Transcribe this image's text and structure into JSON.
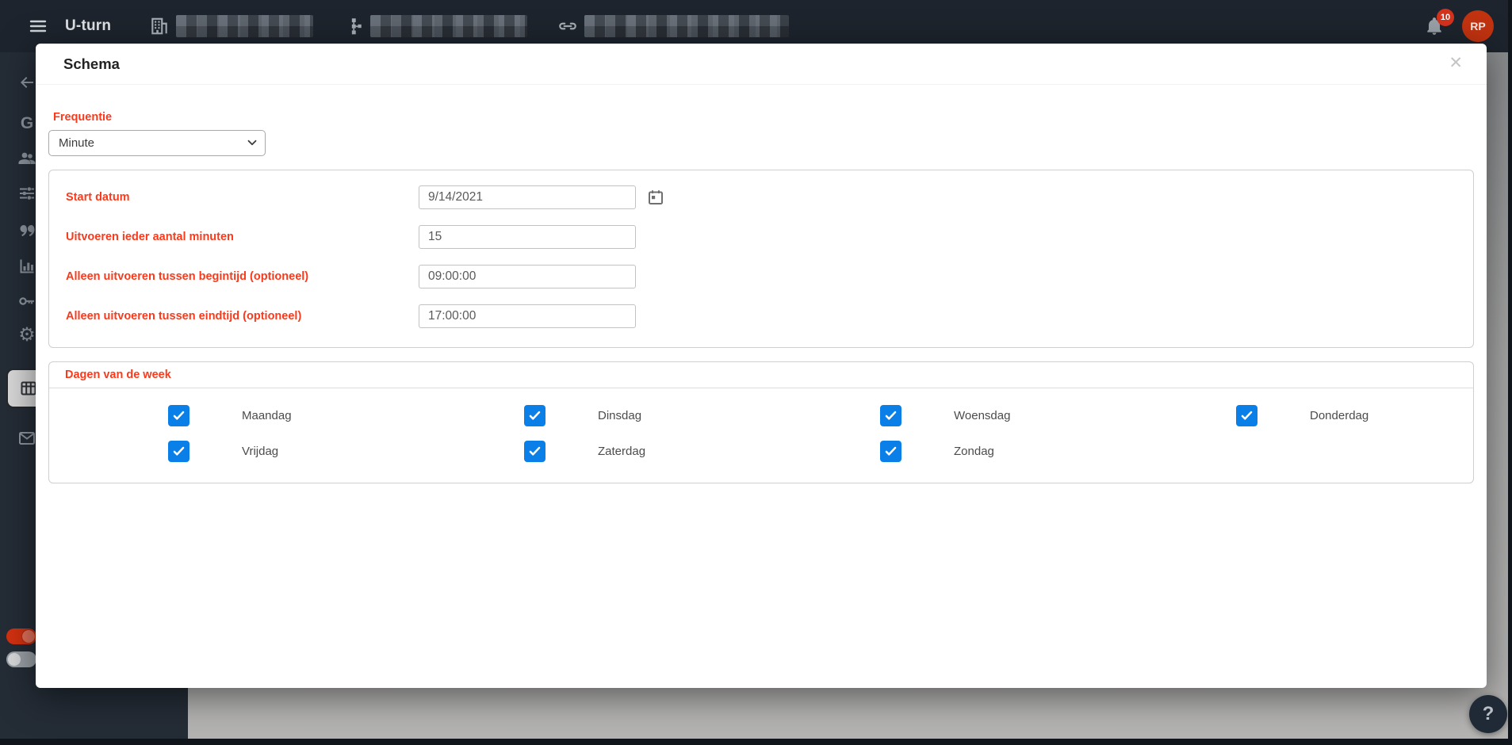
{
  "topbar": {
    "brand": "U-turn",
    "nav_items": [
      {
        "icon": "building-icon"
      },
      {
        "icon": "sitemap-icon"
      },
      {
        "icon": "link-icon"
      }
    ],
    "notification_badge": "10",
    "avatar_initials": "RP"
  },
  "sidebar": {
    "items": [
      {
        "icon": "arrow-left-icon"
      },
      {
        "icon": "globe-icon"
      },
      {
        "icon": "people-icon"
      },
      {
        "icon": "tune-icon"
      },
      {
        "icon": "quote-icon"
      },
      {
        "icon": "bar-chart-icon"
      },
      {
        "icon": "key-icon"
      },
      {
        "icon": "gear-icon"
      },
      {
        "icon": "table-icon",
        "selected": true
      },
      {
        "icon": "mail-icon"
      }
    ],
    "toggles": [
      {
        "state": "on"
      },
      {
        "state": "off"
      }
    ]
  },
  "modal": {
    "title": "Schema",
    "close_glyph": "✕",
    "frequency_label": "Frequentie",
    "frequency_value": "Minute",
    "fields": [
      {
        "label": "Start datum",
        "value": "9/14/2021",
        "trailing_icon": "calendar-icon"
      },
      {
        "label": "Uitvoeren ieder aantal minuten",
        "value": "15"
      },
      {
        "label": "Alleen uitvoeren tussen begintijd (optioneel)",
        "value": "09:00:00"
      },
      {
        "label": "Alleen uitvoeren tussen eindtijd (optioneel)",
        "value": "17:00:00"
      }
    ],
    "days_label": "Dagen van de week",
    "days": [
      {
        "label": "Maandag",
        "checked": true
      },
      {
        "label": "Dinsdag",
        "checked": true
      },
      {
        "label": "Woensdag",
        "checked": true
      },
      {
        "label": "Donderdag",
        "checked": true
      },
      {
        "label": "Vrijdag",
        "checked": true
      },
      {
        "label": "Zaterdag",
        "checked": true
      },
      {
        "label": "Zondag",
        "checked": true
      }
    ]
  },
  "help_button_label": "?",
  "colors": {
    "accent_red": "#fa3a1c",
    "checkbox_blue": "#0b7fe8",
    "avatar_bg": "#c23310",
    "badge_bg": "#d5321d",
    "toggle_on": "#d23110",
    "topbar_bg": "#1d242d",
    "sidebar_bg": "#242c36"
  }
}
